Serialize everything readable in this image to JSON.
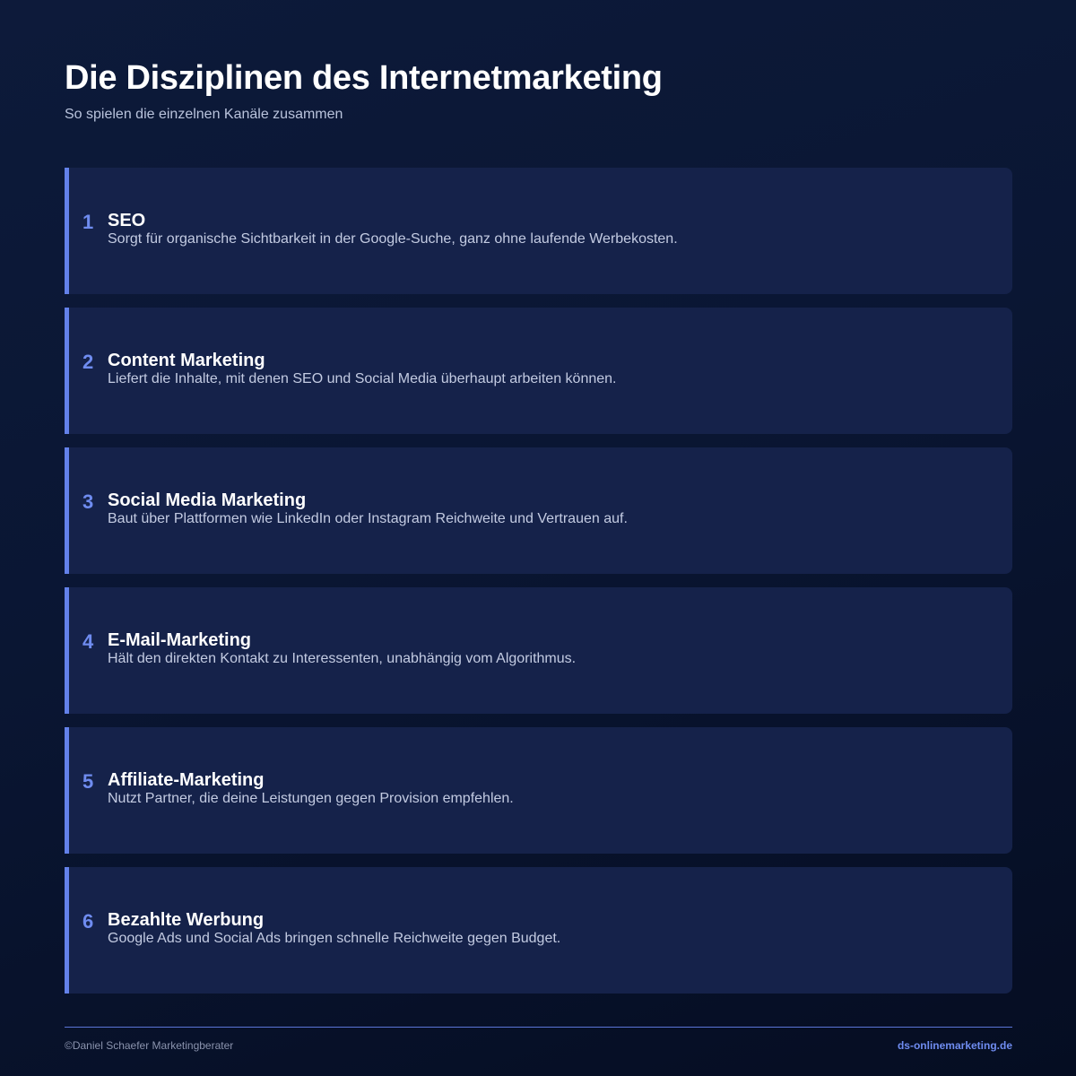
{
  "header": {
    "title": "Die Disziplinen des Internetmarketing",
    "subtitle": "So spielen die einzelnen Kanäle zusammen"
  },
  "items": [
    {
      "number": "1",
      "title": "SEO",
      "description": "Sorgt für organische Sichtbarkeit in der Google-Suche, ganz ohne laufende Werbekosten."
    },
    {
      "number": "2",
      "title": "Content Marketing",
      "description": "Liefert die Inhalte, mit denen SEO und Social Media überhaupt arbeiten können."
    },
    {
      "number": "3",
      "title": "Social Media Marketing",
      "description": "Baut über Plattformen wie LinkedIn oder Instagram Reichweite und Vertrauen auf."
    },
    {
      "number": "4",
      "title": "E-Mail-Marketing",
      "description": "Hält den direkten Kontakt zu Interessenten, unabhängig vom Algorithmus."
    },
    {
      "number": "5",
      "title": "Affiliate-Marketing",
      "description": "Nutzt Partner, die deine Leistungen gegen Provision empfehlen."
    },
    {
      "number": "6",
      "title": "Bezahlte Werbung",
      "description": "Google Ads und Social Ads bringen schnelle Reichweite gegen Budget."
    }
  ],
  "footer": {
    "copyright": "©Daniel Schaefer Marketingberater",
    "website": "ds-onlinemarketing.de"
  },
  "colors": {
    "background": "#0a1633",
    "card": "#15224a",
    "accent": "#6381ea",
    "number": "#6f8cf0"
  }
}
